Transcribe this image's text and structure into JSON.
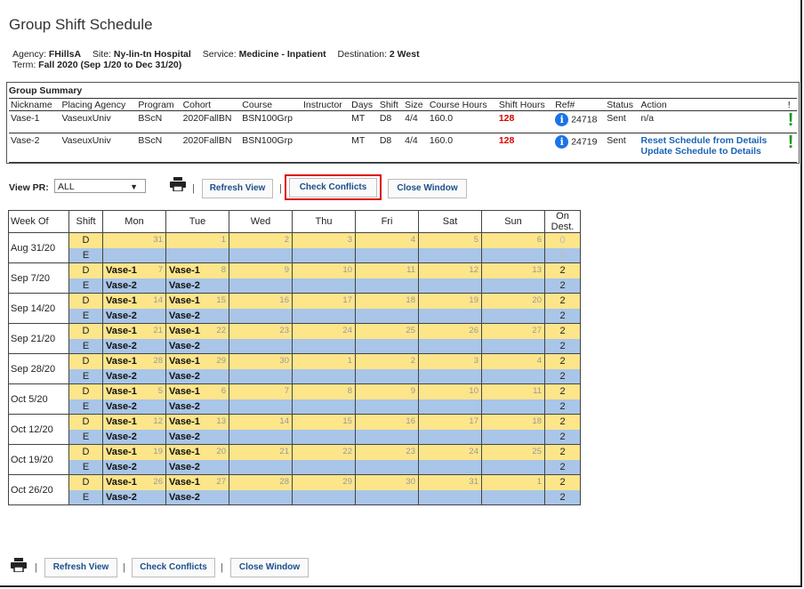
{
  "title": "Group Shift Schedule",
  "info": {
    "agency_label": "Agency:",
    "agency": "FHillsA",
    "site_label": "Site:",
    "site": "Ny-lin-tn Hospital",
    "service_label": "Service:",
    "service": "Medicine - Inpatient",
    "destination_label": "Destination:",
    "destination": "2 West",
    "term_label": "Term:",
    "term": "Fall 2020",
    "term_range": "(Sep 1/20 to Dec 31/20)"
  },
  "summary": {
    "title": "Group Summary",
    "headers": [
      "Nickname",
      "Placing Agency",
      "Program",
      "Cohort",
      "Course",
      "Instructor",
      "Days",
      "Shift",
      "Size",
      "Course Hours",
      "Shift Hours",
      "Ref#",
      "Status",
      "Action",
      "!"
    ],
    "rows": [
      {
        "nickname": "Vase-1",
        "agency": "VaseuxUniv",
        "program": "BScN",
        "cohort": "2020FallBN",
        "course": "BSN100Grp",
        "instructor": "",
        "days": "MT",
        "shift": "D8",
        "size": "4/4",
        "course_hours": "160.0",
        "shift_hours": "128",
        "ref": "24718",
        "status": "Sent",
        "action1": "n/a",
        "action2": "",
        "alert": "!"
      },
      {
        "nickname": "Vase-2",
        "agency": "VaseuxUniv",
        "program": "BScN",
        "cohort": "2020FallBN",
        "course": "BSN100Grp",
        "instructor": "",
        "days": "MT",
        "shift": "D8",
        "size": "4/4",
        "course_hours": "160.0",
        "shift_hours": "128",
        "ref": "24719",
        "status": "Sent",
        "action1": "Reset Schedule from Details",
        "action2": "Update Schedule to Details",
        "alert": "!"
      }
    ]
  },
  "toolbar": {
    "view_pr_label": "View PR:",
    "view_pr_value": "ALL",
    "refresh": "Refresh View",
    "check": "Check Conflicts",
    "close": "Close Window",
    "separator": "|"
  },
  "calendar": {
    "headers": [
      "Week Of",
      "Shift",
      "Mon",
      "Tue",
      "Wed",
      "Thu",
      "Fri",
      "Sat",
      "Sun",
      "On Dest."
    ],
    "weeks": [
      {
        "week": "Aug 31/20",
        "dates": [
          "31",
          "1",
          "2",
          "3",
          "4",
          "5",
          "6"
        ],
        "d": [
          "",
          "",
          "",
          "",
          "",
          "",
          ""
        ],
        "e": [
          "",
          "",
          "",
          "",
          "",
          "",
          ""
        ],
        "d_dest": "0",
        "e_dest": "0"
      },
      {
        "week": "Sep 7/20",
        "dates": [
          "7",
          "8",
          "9",
          "10",
          "11",
          "12",
          "13"
        ],
        "d": [
          "Vase-1",
          "Vase-1",
          "",
          "",
          "",
          "",
          ""
        ],
        "e": [
          "Vase-2",
          "Vase-2",
          "",
          "",
          "",
          "",
          ""
        ],
        "d_dest": "2",
        "e_dest": "2"
      },
      {
        "week": "Sep 14/20",
        "dates": [
          "14",
          "15",
          "16",
          "17",
          "18",
          "19",
          "20"
        ],
        "d": [
          "Vase-1",
          "Vase-1",
          "",
          "",
          "",
          "",
          ""
        ],
        "e": [
          "Vase-2",
          "Vase-2",
          "",
          "",
          "",
          "",
          ""
        ],
        "d_dest": "2",
        "e_dest": "2"
      },
      {
        "week": "Sep 21/20",
        "dates": [
          "21",
          "22",
          "23",
          "24",
          "25",
          "26",
          "27"
        ],
        "d": [
          "Vase-1",
          "Vase-1",
          "",
          "",
          "",
          "",
          ""
        ],
        "e": [
          "Vase-2",
          "Vase-2",
          "",
          "",
          "",
          "",
          ""
        ],
        "d_dest": "2",
        "e_dest": "2"
      },
      {
        "week": "Sep 28/20",
        "dates": [
          "28",
          "29",
          "30",
          "1",
          "2",
          "3",
          "4"
        ],
        "d": [
          "Vase-1",
          "Vase-1",
          "",
          "",
          "",
          "",
          ""
        ],
        "e": [
          "Vase-2",
          "Vase-2",
          "",
          "",
          "",
          "",
          ""
        ],
        "d_dest": "2",
        "e_dest": "2"
      },
      {
        "week": "Oct 5/20",
        "dates": [
          "5",
          "6",
          "7",
          "8",
          "9",
          "10",
          "11"
        ],
        "d": [
          "Vase-1",
          "Vase-1",
          "",
          "",
          "",
          "",
          ""
        ],
        "e": [
          "Vase-2",
          "Vase-2",
          "",
          "",
          "",
          "",
          ""
        ],
        "d_dest": "2",
        "e_dest": "2"
      },
      {
        "week": "Oct 12/20",
        "dates": [
          "12",
          "13",
          "14",
          "15",
          "16",
          "17",
          "18"
        ],
        "d": [
          "Vase-1",
          "Vase-1",
          "",
          "",
          "",
          "",
          ""
        ],
        "e": [
          "Vase-2",
          "Vase-2",
          "",
          "",
          "",
          "",
          ""
        ],
        "d_dest": "2",
        "e_dest": "2"
      },
      {
        "week": "Oct 19/20",
        "dates": [
          "19",
          "20",
          "21",
          "22",
          "23",
          "24",
          "25"
        ],
        "d": [
          "Vase-1",
          "Vase-1",
          "",
          "",
          "",
          "",
          ""
        ],
        "e": [
          "Vase-2",
          "Vase-2",
          "",
          "",
          "",
          "",
          ""
        ],
        "d_dest": "2",
        "e_dest": "2"
      },
      {
        "week": "Oct 26/20",
        "dates": [
          "26",
          "27",
          "28",
          "29",
          "30",
          "31",
          "1"
        ],
        "d": [
          "Vase-1",
          "Vase-1",
          "",
          "",
          "",
          "",
          ""
        ],
        "e": [
          "Vase-2",
          "Vase-2",
          "",
          "",
          "",
          "",
          ""
        ],
        "d_dest": "2",
        "e_dest": "2"
      }
    ],
    "shift_labels": {
      "d": "D",
      "e": "E"
    }
  },
  "colors": {
    "day_row": "#fde58a",
    "evening_row": "#a9c5e8",
    "alert": "#1a9a1a",
    "hours": "#d00",
    "highlight": "#d00"
  }
}
